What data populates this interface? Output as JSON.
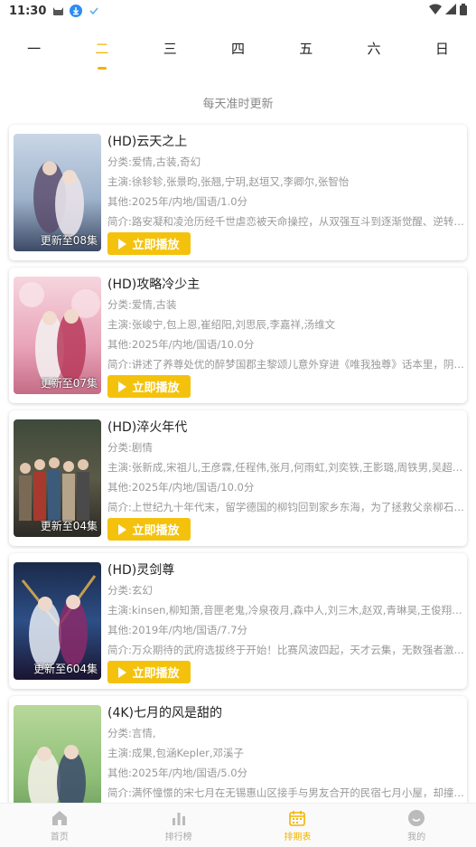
{
  "status_bar": {
    "time": "11:30"
  },
  "day_tabs": [
    "一",
    "二",
    "三",
    "四",
    "五",
    "六",
    "日"
  ],
  "active_day_index": 1,
  "update_note": "每天准时更新",
  "play_label": "立即播放",
  "cards": [
    {
      "title": "(HD)云天之上",
      "genre": "分类:爱情,古装,奇幻",
      "cast": "主演:徐轸轸,张景昀,张翘,宁玥,赵垣又,李卿尔,张智怡",
      "other": "其他:2025年/内地/国语/1.0分",
      "summary": "简介:路安凝和凌沧历经千世虐恋被天命操控，从双强互斗到逐渐觉醒、逆转…",
      "episode": "更新至08集"
    },
    {
      "title": "(HD)攻略冷少主",
      "genre": "分类:爱情,古装",
      "cast": "主演:张峻宁,包上恩,崔绍阳,刘思辰,李嘉祥,汤维文",
      "other": "其他:2025年/内地/国语/10.0分",
      "summary": "简介:讲述了养尊处优的醉梦国郡主黎颂儿意外穿进《唯我独尊》话本里，阴…",
      "episode": "更新至07集"
    },
    {
      "title": "(HD)淬火年代",
      "genre": "分类:剧情",
      "cast": "主演:张新成,宋祖儿,王彦霖,任程伟,张月,何雨虹,刘奕铁,王影璐,周铁男,吴超,高…",
      "other": "其他:2025年/内地/国语/10.0分",
      "summary": "简介:上世纪九十年代末，留学德国的柳钧回到家乡东海，为了拯救父亲柳石…",
      "episode": "更新至04集"
    },
    {
      "title": "(HD)灵剑尊",
      "genre": "分类:玄幻",
      "cast": "主演:kinsen,柳知萧,音匣老鬼,冷泉夜月,森中人,刘三木,赵双,青琳昊,王俊翔,四喜",
      "other": "其他:2019年/内地/国语/7.7分",
      "summary": "简介:万众期待的武府选拔终于开始！比赛风波四起，天才云集，无数强者激…",
      "episode": "更新至604集"
    },
    {
      "title": "(4K)七月的风是甜的",
      "genre": "分类:言情,",
      "cast": "主演:成果,包涵Kepler,邓溪子",
      "other": "其他:2025年/内地/国语/5.0分",
      "summary": "简介:满怀憧憬的宋七月在无锡惠山区接手与男友合开的民宿七月小屋，却撞…",
      "episode": ""
    }
  ],
  "bottom_nav": [
    "首页",
    "排行榜",
    "排期表",
    "我的"
  ],
  "active_nav_index": 2,
  "colors": {
    "accent": "#f4c20d",
    "accent_text": "#f4b400"
  }
}
